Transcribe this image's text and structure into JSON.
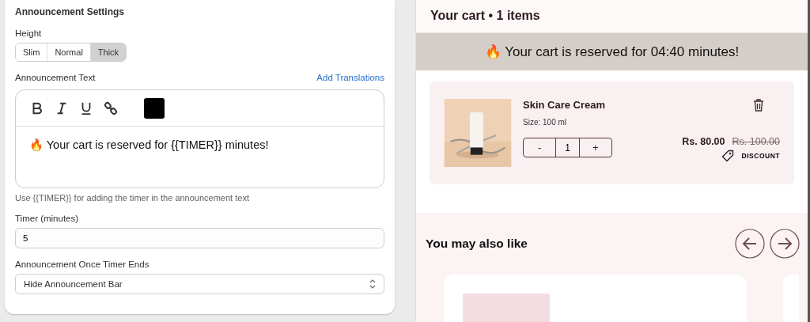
{
  "settings": {
    "title": "Announcement Settings",
    "height": {
      "label": "Height",
      "options": [
        {
          "label": "Slim",
          "selected": false
        },
        {
          "label": "Normal",
          "selected": false
        },
        {
          "label": "Thick",
          "selected": true
        }
      ]
    },
    "announcement_text": {
      "label": "Announcement Text",
      "link": "Add Translations",
      "color": "#000000",
      "value": "🔥 Your cart is reserved for {{TIMER}} minutes!",
      "help": "Use {{TIMER}} for adding the timer in the announcement text"
    },
    "timer": {
      "label": "Timer (minutes)",
      "value": "5"
    },
    "after": {
      "label": "Announcement Once Timer Ends",
      "value": "Hide Announcement Bar"
    }
  },
  "preview": {
    "cart_title": "Your cart • 1 items",
    "banner": "🔥 Your cart is reserved for 04:40 minutes!",
    "item": {
      "kind": "picture",
      "name": "Skin Care Cream",
      "size": "Size: 100 ml",
      "quantity": "1",
      "minus": "-",
      "plus": "+",
      "price": "Rs. 80.00",
      "old_price": "Rs. 100.00",
      "discount": "DISCOUNT"
    },
    "recommendations": {
      "title": "You may also like"
    }
  }
}
